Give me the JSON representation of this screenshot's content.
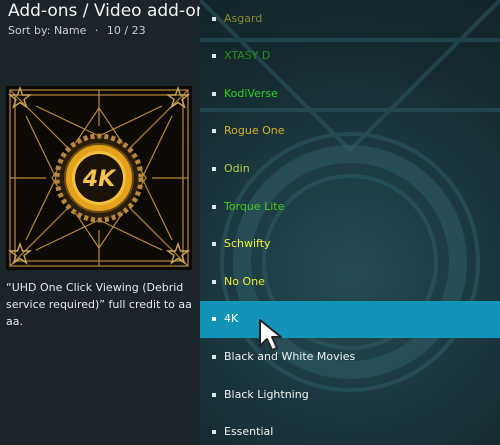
{
  "header": {
    "title": "Add-ons / Video add-ons",
    "sort_label": "Sort by: Name",
    "separator": "·",
    "position": "10 / 23"
  },
  "thumbnail": {
    "badge": "4K"
  },
  "description": "“UHD One Click Viewing (Debrid service required)” full credit to aa aa.",
  "list": {
    "items": [
      {
        "label": "Asgard",
        "color": "#8a8a2e"
      },
      {
        "label": "XTASY D",
        "color": "#2f8f1c"
      },
      {
        "label": "KodiVerse",
        "color": "#2fd21f"
      },
      {
        "label": "Rogue One",
        "color": "#d5b12b"
      },
      {
        "label": "Odin",
        "color": "#b5d04a"
      },
      {
        "label": "Torque Lite",
        "color": "#47c71e"
      },
      {
        "label": "Schwifty",
        "color": "#f1f33a"
      },
      {
        "label": "No One",
        "color": "#e8ea30"
      },
      {
        "label": "4K",
        "color": "#ffffff"
      },
      {
        "label": "Black and White Movies",
        "color": "#f0f0f0"
      },
      {
        "label": "Black Lightning",
        "color": "#f0f0f0"
      },
      {
        "label": "Essential",
        "color": "#f0f0f0"
      }
    ],
    "selected_index": 8
  }
}
